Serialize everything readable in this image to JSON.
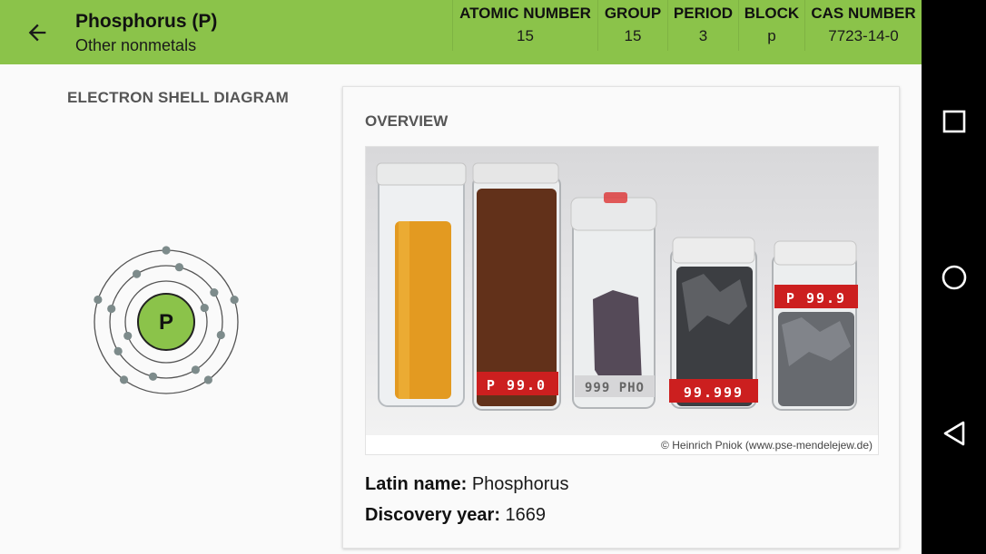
{
  "header": {
    "title": "Phosphorus (P)",
    "subtitle": "Other nonmetals",
    "back_icon": "arrow-back-icon",
    "background": "#8bc34a",
    "stats": [
      {
        "label": "ATOMIC NUMBER",
        "value": "15"
      },
      {
        "label": "GROUP",
        "value": "15"
      },
      {
        "label": "PERIOD",
        "value": "3"
      },
      {
        "label": "BLOCK",
        "value": "p"
      },
      {
        "label": "CAS NUMBER",
        "value": "7723-14-0"
      }
    ]
  },
  "shell_diagram": {
    "title": "ELECTRON SHELL DIAGRAM",
    "symbol": "P",
    "shells": [
      2,
      8,
      5
    ],
    "nucleus_color": "#8bc34a"
  },
  "overview": {
    "title": "OVERVIEW",
    "image_credit": "© Heinrich Pniok (www.pse-mendelejew.de)",
    "latin_name_label": "Latin name:",
    "latin_name": "Phosphorus",
    "discovery_year_label": "Discovery year:",
    "discovery_year": "1669",
    "jar_labels": [
      "P 99.0",
      "999 PHO",
      "99.999",
      "P 99.9"
    ]
  },
  "navbar": {
    "recents_icon": "square-recents-icon",
    "home_icon": "circle-home-icon",
    "back_icon": "triangle-back-icon"
  }
}
